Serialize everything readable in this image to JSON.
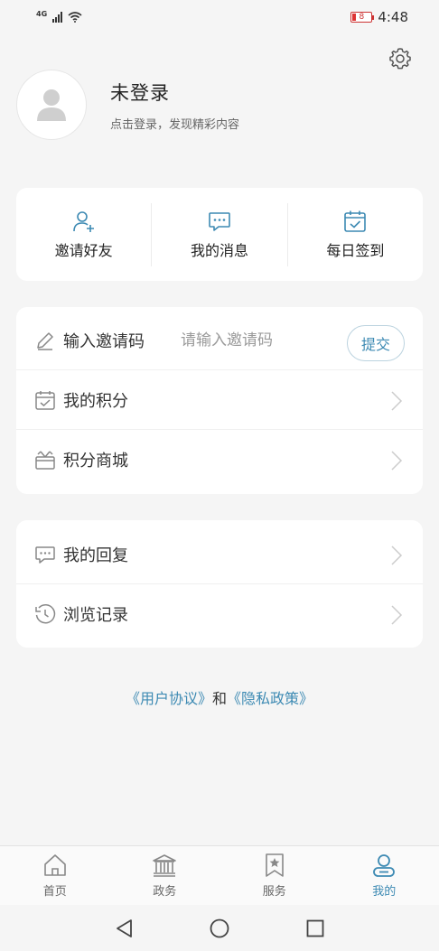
{
  "status_bar": {
    "network": "4G",
    "battery": "8",
    "time": "4:48"
  },
  "profile": {
    "name": "未登录",
    "subtitle": "点击登录，发现精彩内容"
  },
  "quick_actions": [
    {
      "label": "邀请好友",
      "icon": "user-add-icon"
    },
    {
      "label": "我的消息",
      "icon": "message-icon"
    },
    {
      "label": "每日签到",
      "icon": "calendar-check-icon"
    }
  ],
  "invite": {
    "label": "输入邀请码",
    "placeholder": "请输入邀请码",
    "submit": "提交"
  },
  "menu_group_1": [
    {
      "label": "我的积分",
      "icon": "calendar-points-icon"
    },
    {
      "label": "积分商城",
      "icon": "gift-box-icon"
    }
  ],
  "menu_group_2": [
    {
      "label": "我的回复",
      "icon": "reply-icon"
    },
    {
      "label": "浏览记录",
      "icon": "history-icon"
    }
  ],
  "agreement": {
    "user_agreement": "《用户协议》",
    "and": "和",
    "privacy_policy": "《隐私政策》"
  },
  "bottom_nav": [
    {
      "label": "首页",
      "icon": "home-icon"
    },
    {
      "label": "政务",
      "icon": "government-icon"
    },
    {
      "label": "服务",
      "icon": "service-icon"
    },
    {
      "label": "我的",
      "icon": "profile-icon",
      "active": true
    }
  ],
  "colors": {
    "accent": "#3d8ab3",
    "background": "#f5f5f5",
    "card": "#ffffff"
  }
}
